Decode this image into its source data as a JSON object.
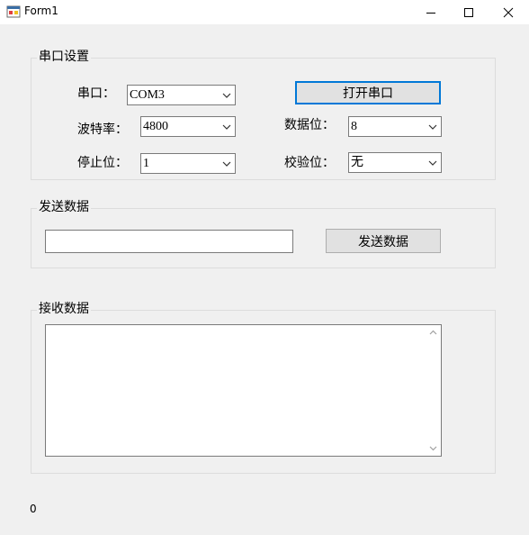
{
  "window": {
    "title": "Form1"
  },
  "serial_settings": {
    "group_title": "串口设置",
    "port_label": "串口：",
    "port_value": "COM3",
    "baud_label": "波特率：",
    "baud_value": "4800",
    "stop_label": "停止位：",
    "stop_value": "1",
    "data_bits_label": "数据位：",
    "data_bits_value": "8",
    "parity_label": "校验位：",
    "parity_value": "无",
    "open_button": "打开串口"
  },
  "send": {
    "group_title": "发送数据",
    "input_value": "",
    "send_button": "发送数据"
  },
  "receive": {
    "group_title": "接收数据",
    "text": ""
  },
  "status_value": "0",
  "icons": {
    "app": "form-app-icon",
    "minimize": "minimize-icon",
    "maximize": "maximize-icon",
    "close": "close-icon",
    "dropdown": "chevron-down-icon",
    "scroll_up": "scroll-up-icon",
    "scroll_down": "scroll-down-icon"
  },
  "colors": {
    "focus_accent": "#0078d7",
    "button_bg": "#e1e1e1",
    "window_bg": "#f0f0f0"
  }
}
